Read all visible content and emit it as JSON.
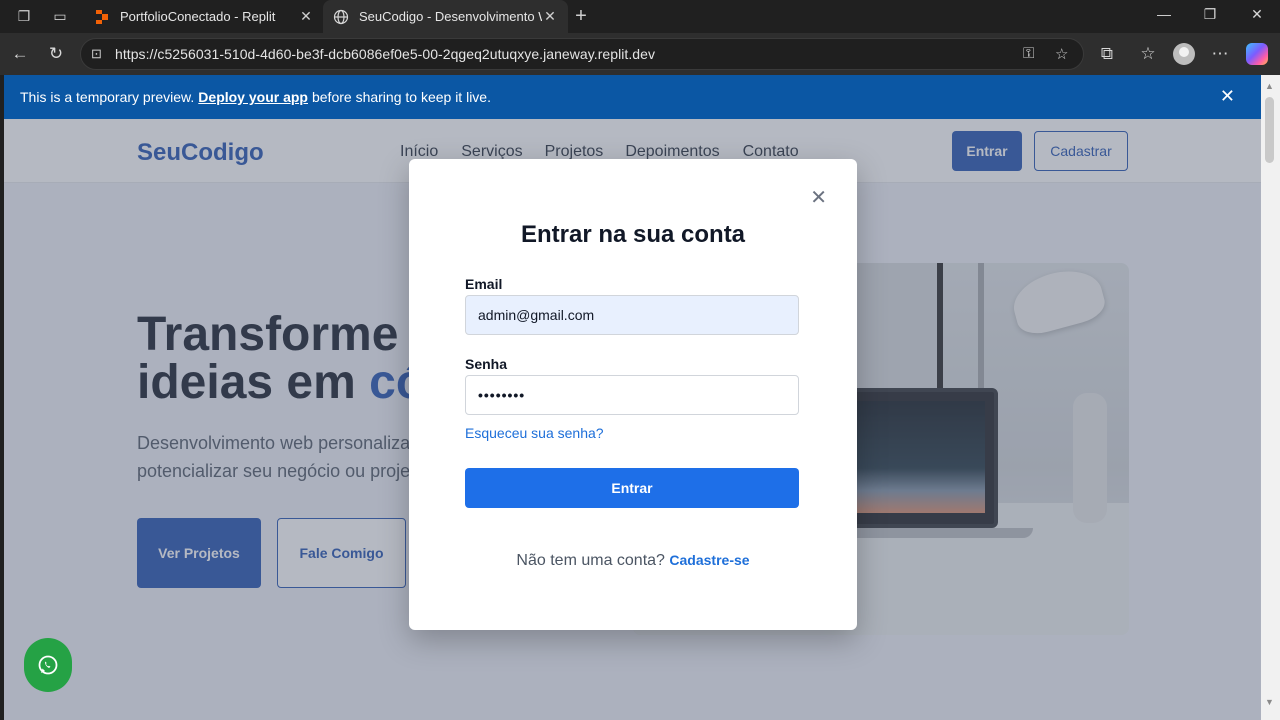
{
  "browser": {
    "tabs": [
      {
        "title": "PortfolioConectado - Replit"
      },
      {
        "title": "SeuCodigo - Desenvolvimento We"
      }
    ],
    "url": "https://c5256031-510d-4d60-be3f-dcb6086ef0e5-00-2qgeq2utuqxye.janeway.replit.dev"
  },
  "banner": {
    "text_before": "This is a temporary preview.",
    "link": "Deploy your app",
    "text_after": "before sharing to keep it live."
  },
  "header": {
    "logo": "SeuCodigo",
    "nav": [
      "Início",
      "Serviços",
      "Projetos",
      "Depoimentos",
      "Contato"
    ],
    "login_label": "Entrar",
    "signup_label": "Cadastrar"
  },
  "hero": {
    "title_line1": "Transforme s",
    "title_line2_a": "ideias em ",
    "title_line2_b": "có",
    "subtitle_line1": "Desenvolvimento web personaliza",
    "subtitle_line2": "potencializar seu negócio ou proje",
    "primary_cta": "Ver Projetos",
    "secondary_cta": "Fale Comigo"
  },
  "modal": {
    "title": "Entrar na sua conta",
    "email_label": "Email",
    "email_value": "admin@gmail.com",
    "password_label": "Senha",
    "password_value": "••••••••",
    "forgot_link": "Esqueceu sua senha?",
    "submit_label": "Entrar",
    "signup_prompt": "Não tem uma conta?",
    "signup_link": "Cadastre-se"
  },
  "colors": {
    "brand_blue": "#1e4fb0",
    "action_blue": "#1e6fe8",
    "banner_blue": "#0b57a4",
    "whatsapp_green": "#25a245"
  }
}
